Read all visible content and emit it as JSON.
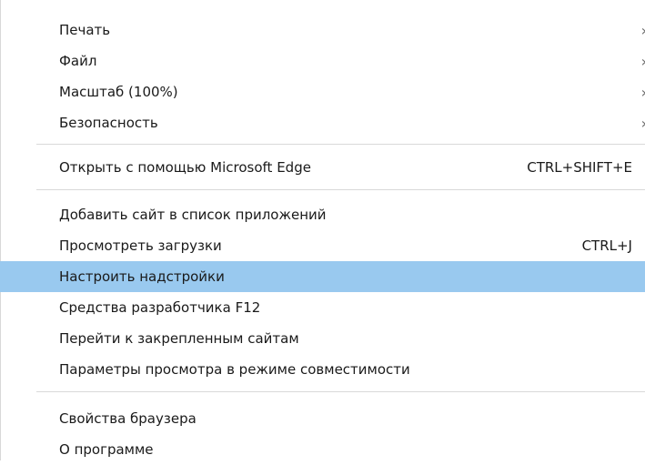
{
  "menu": {
    "group1": [
      {
        "label": "Печать",
        "arrow": "›"
      },
      {
        "label": "Файл",
        "arrow": "›"
      },
      {
        "label": "Масштаб (100%)",
        "arrow": "›"
      },
      {
        "label": "Безопасность",
        "arrow": "›"
      }
    ],
    "group2": [
      {
        "label": "Открыть с помощью Microsoft Edge",
        "shortcut": "CTRL+SHIFT+E"
      }
    ],
    "group3": [
      {
        "label": "Добавить сайт в список приложений"
      },
      {
        "label": "Просмотреть загрузки",
        "shortcut": "CTRL+J"
      },
      {
        "label": "Настроить надстройки",
        "highlighted": true
      },
      {
        "label": "Средства разработчика F12"
      },
      {
        "label": "Перейти к закрепленным сайтам"
      },
      {
        "label": "Параметры просмотра в режиме совместимости"
      }
    ],
    "group4": [
      {
        "label": "Свойства браузера"
      },
      {
        "label": "О программе"
      }
    ]
  },
  "colors": {
    "highlight": "#99c9ef",
    "separator": "#d9d9d9",
    "text": "#1a1a1a"
  }
}
